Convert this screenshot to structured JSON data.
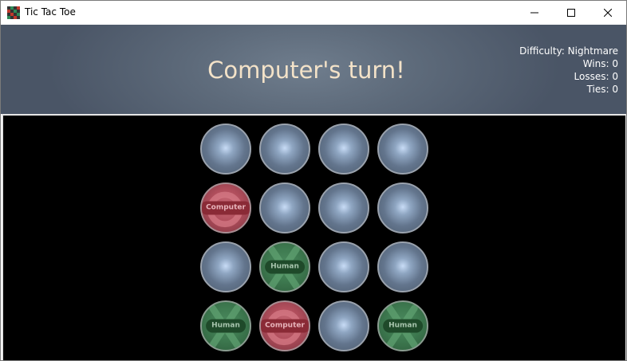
{
  "window": {
    "title": "Tic Tac Toe",
    "icon": "tic-tac-toe-app-icon",
    "controls": [
      "minimize-icon",
      "maximize-icon",
      "close-icon"
    ]
  },
  "header": {
    "status": "Computer's turn!",
    "difficulty": "Difficulty: Nightmare",
    "wins": "Wins: 0",
    "losses": "Losses: 0",
    "ties": "Ties: 0"
  },
  "board": {
    "rows": 4,
    "cols": 4,
    "cells": [
      {
        "state": "empty",
        "label": ""
      },
      {
        "state": "empty",
        "label": ""
      },
      {
        "state": "empty",
        "label": ""
      },
      {
        "state": "empty",
        "label": ""
      },
      {
        "state": "computer",
        "label": "Computer"
      },
      {
        "state": "empty",
        "label": ""
      },
      {
        "state": "empty",
        "label": ""
      },
      {
        "state": "empty",
        "label": ""
      },
      {
        "state": "empty",
        "label": ""
      },
      {
        "state": "human",
        "label": "Human"
      },
      {
        "state": "empty",
        "label": ""
      },
      {
        "state": "empty",
        "label": ""
      },
      {
        "state": "human",
        "label": "Human"
      },
      {
        "state": "computer",
        "label": "Computer"
      },
      {
        "state": "empty",
        "label": ""
      },
      {
        "state": "human",
        "label": "Human"
      }
    ]
  },
  "colors": {
    "header_text": "#f3e2c8",
    "board_background": "#000000",
    "human": "#3e7a50",
    "computer": "#b04e5c",
    "empty": "#63758d"
  }
}
